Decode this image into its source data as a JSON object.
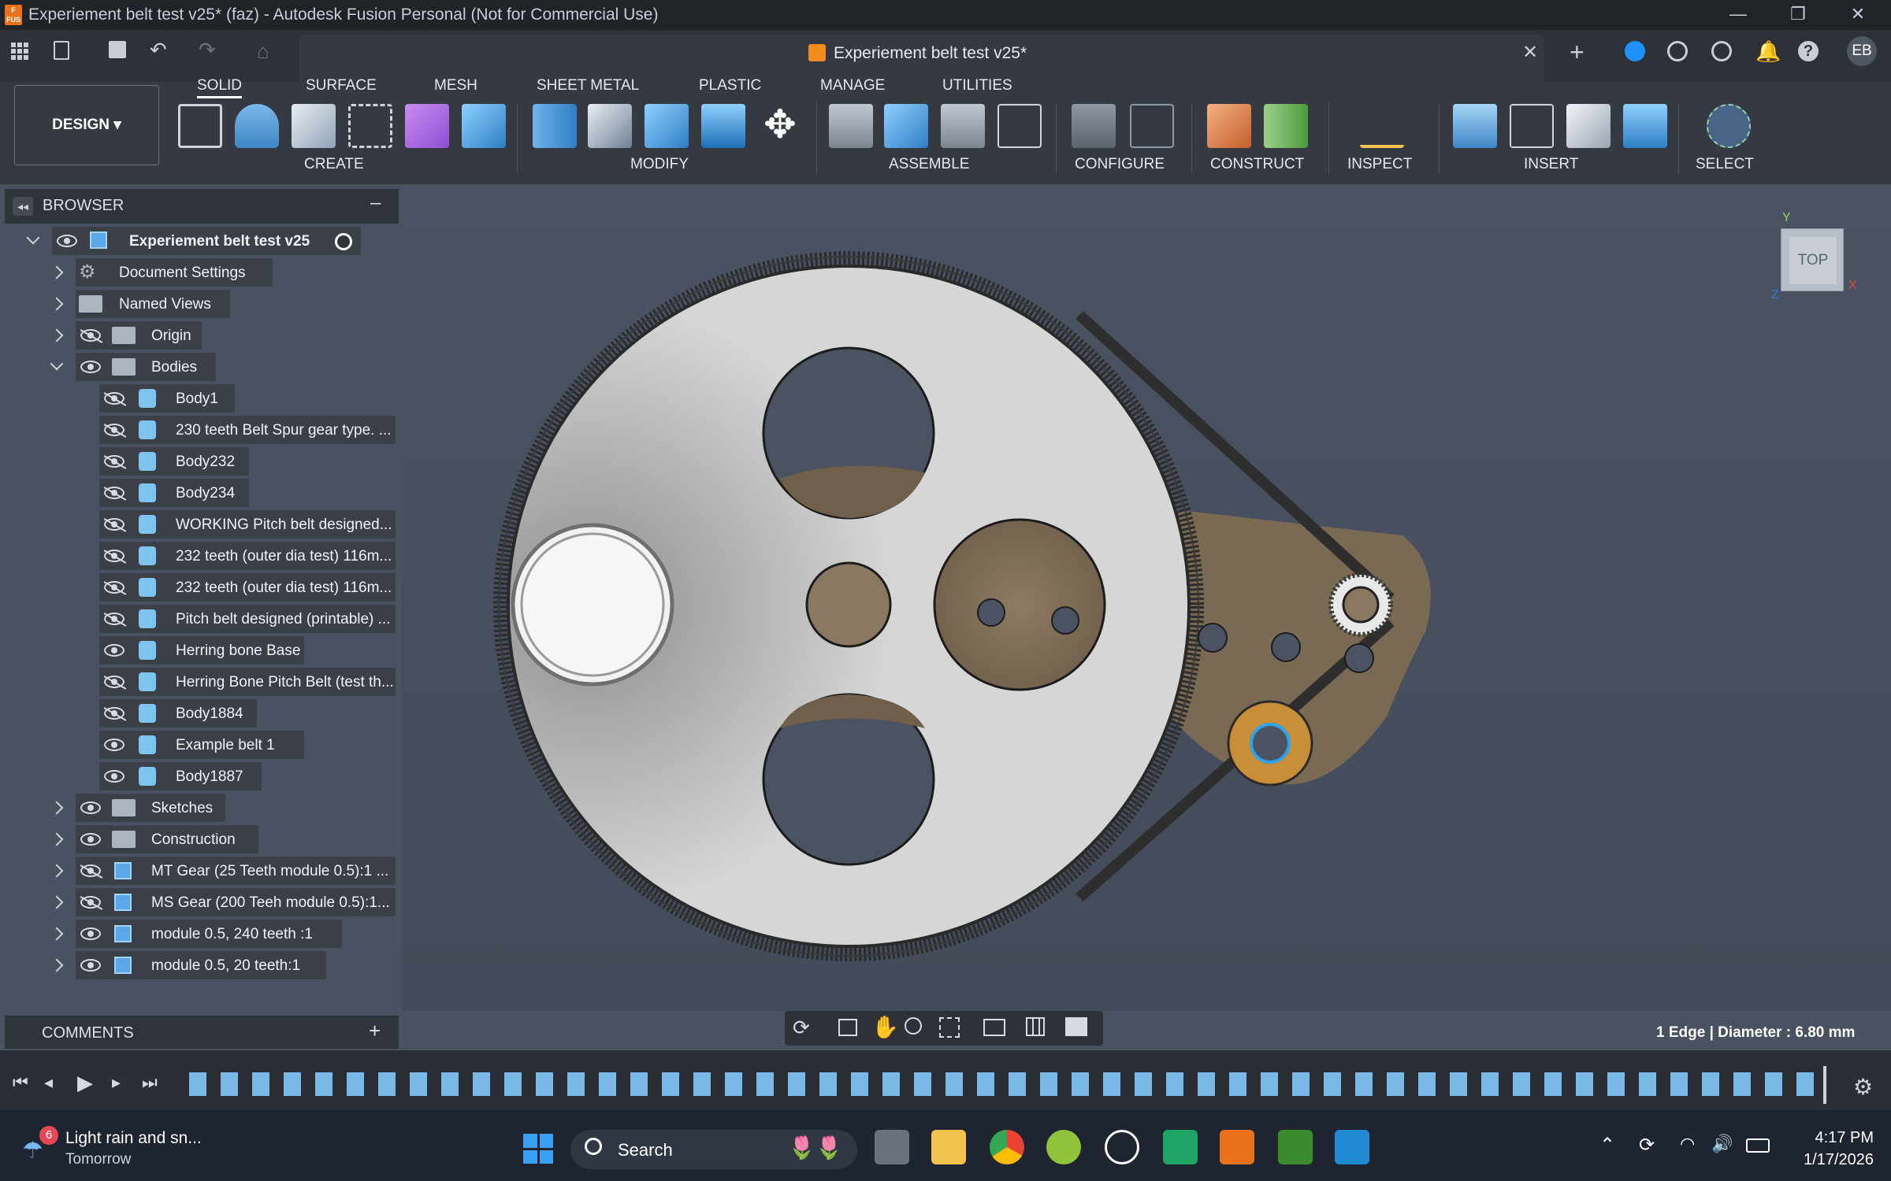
{
  "window": {
    "title": "Experiement belt test v25* (faz) - Autodesk Fusion Personal (Not for Commercial Use)",
    "logo_text": "F\nFUS"
  },
  "document_tab": {
    "title": "Experiement belt test v25*"
  },
  "user_initials": "EB",
  "workspace": {
    "label": "DESIGN"
  },
  "ribbon_tabs": [
    "SOLID",
    "SURFACE",
    "MESH",
    "SHEET METAL",
    "PLASTIC",
    "MANAGE",
    "UTILITIES"
  ],
  "ribbon_groups": [
    "CREATE",
    "MODIFY",
    "ASSEMBLE",
    "CONFIGURE",
    "CONSTRUCT",
    "INSPECT",
    "INSERT",
    "SELECT"
  ],
  "browser": {
    "title": "BROWSER",
    "root": "Experiement belt test v25",
    "items": [
      {
        "label": "Document Settings"
      },
      {
        "label": "Named Views"
      },
      {
        "label": "Origin"
      },
      {
        "label": "Bodies"
      },
      {
        "label": "Body1"
      },
      {
        "label": "230 teeth Belt Spur gear type. ..."
      },
      {
        "label": "Body232"
      },
      {
        "label": "Body234"
      },
      {
        "label": "WORKING Pitch belt designed..."
      },
      {
        "label": "232 teeth (outer dia test) 116m..."
      },
      {
        "label": "232 teeth (outer dia test) 116m..."
      },
      {
        "label": "Pitch belt designed (printable) ..."
      },
      {
        "label": "Herring bone Base"
      },
      {
        "label": "Herring Bone Pitch Belt (test th..."
      },
      {
        "label": "Body1884"
      },
      {
        "label": "Example belt 1"
      },
      {
        "label": "Body1887"
      },
      {
        "label": "Sketches"
      },
      {
        "label": "Construction"
      },
      {
        "label": "MT Gear (25 Teeth module 0.5):1 ..."
      },
      {
        "label": "MS Gear (200 Teeh module 0.5):1..."
      },
      {
        "label": "module 0.5, 240 teeth :1"
      },
      {
        "label": "module 0.5, 20 teeth:1"
      }
    ]
  },
  "comments": {
    "label": "COMMENTS"
  },
  "viewcube": {
    "face": "TOP",
    "axis_y": "Y",
    "axis_z": "Z",
    "axis_x": "X"
  },
  "status": {
    "text": "1 Edge | Diameter : 6.80 mm"
  },
  "taskbar": {
    "weather_badge": "6",
    "weather_line1": "Light rain and sn...",
    "weather_line2": "Tomorrow",
    "search_placeholder": "Search",
    "time": "4:17 PM",
    "date": "1/17/2026"
  },
  "colors": {
    "accent": "#1ea7fd",
    "brand": "#e8731c"
  }
}
